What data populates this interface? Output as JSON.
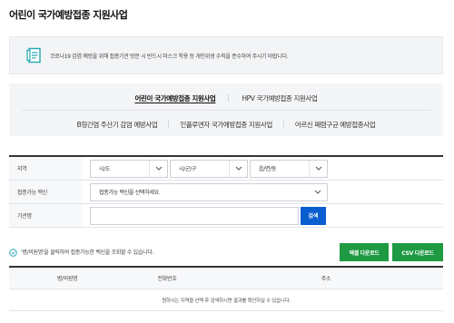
{
  "page": {
    "title": "어린이 국가예방접종 지원사업"
  },
  "notice": {
    "text": "코로나19 감염 예방을 위해 접종기관 방문 시 반드시 마스크 착용 등 개인위생 수칙을 준수하여 주시기 바랍니다."
  },
  "tabs": {
    "row1": [
      {
        "label": "어린이 국가예방접종 지원사업",
        "active": true
      },
      {
        "label": "HPV 국가예방접종 지원사업",
        "active": false
      }
    ],
    "row2": [
      {
        "label": "B형간염 주산기 감염 예방사업",
        "active": false
      },
      {
        "label": "인플루엔자 국가예방접종 지원사업",
        "active": false
      },
      {
        "label": "어르신 폐렴구균 예방접종사업",
        "active": false
      }
    ]
  },
  "form": {
    "region": {
      "label": "지역",
      "sido": "시/도",
      "sigungu": "시/군/구",
      "dong": "읍/면/동"
    },
    "vaccine": {
      "label": "접종가능 백신",
      "placeholder": "접종가능 백신을 선택하세요."
    },
    "org": {
      "label": "기관명",
      "value": "",
      "search": "검색"
    }
  },
  "hint": {
    "text": "'병/의원명'을 클릭하여 접종가능한 백신을 조회할 수 있습니다."
  },
  "downloads": {
    "excel": "엑셀 다운로드",
    "csv": "CSV 다운로드"
  },
  "table": {
    "columns": [
      "병/의원명",
      "전화번호",
      "주소"
    ],
    "empty": "원하시는 지역을 선택 후 검색하시면 결과를 확인하실 수 있습니다."
  },
  "colors": {
    "primary": "#0a5ecf",
    "download": "#1e9a43",
    "accent_teal": "#23a6b3"
  }
}
